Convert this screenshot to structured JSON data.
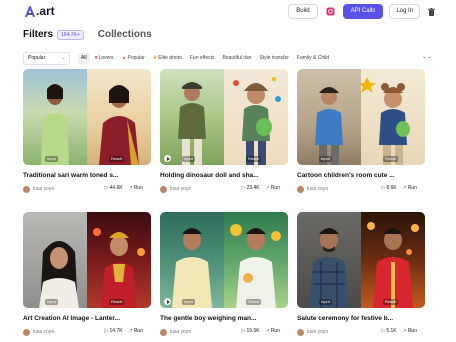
{
  "header": {
    "logo_text": ".art",
    "build_label": "Build",
    "api_label": "API Calls",
    "login_label": "Log In"
  },
  "colors": {
    "accent": "#5a52e8",
    "text": "#111111"
  },
  "titles": {
    "filters": "Filters",
    "count_badge": "154.7K+",
    "collections": "Collections"
  },
  "filters": {
    "sort_value": "Popular",
    "chips": [
      {
        "label": "All",
        "icon": ""
      },
      {
        "label": "Lovers",
        "icon": "heart-icon"
      },
      {
        "label": "Popular",
        "icon": "fire-icon"
      },
      {
        "label": "Elite photo",
        "icon": "crown-icon"
      },
      {
        "label": "Fun effects",
        "icon": ""
      },
      {
        "label": "Beautiful tian",
        "icon": ""
      },
      {
        "label": "Style transfer",
        "icon": ""
      },
      {
        "label": "Family & Child",
        "icon": ""
      }
    ]
  },
  "cards": [
    {
      "title": "Traditional sari warm toned s...",
      "author": "lusa yoyo",
      "views": "44.6K",
      "runs": "Run",
      "input_tag": "Input",
      "result_tag": "Result"
    },
    {
      "title": "Holding dinosaur doll and sha...",
      "author": "lusa yoyo",
      "views": "23.4K",
      "runs": "Run",
      "input_tag": "Input",
      "result_tag": "Result"
    },
    {
      "title": "Cartoon children's room cute ...",
      "author": "lusa yoyo",
      "views": "8.6K",
      "runs": "Run",
      "input_tag": "Input",
      "result_tag": "Result"
    },
    {
      "title": "Art Creation AI Image - Lanter...",
      "author": "lusa yoyo",
      "views": "14.7K",
      "runs": "Run",
      "input_tag": "Input",
      "result_tag": "Result"
    },
    {
      "title": "The gentle boy weighing man...",
      "author": "lusa yoyo",
      "views": "19.5K",
      "runs": "Run",
      "input_tag": "Input",
      "result_tag": "Result"
    },
    {
      "title": "Salute ceremony for festive b...",
      "author": "lusa yoyo",
      "views": "5.1K",
      "runs": "Run",
      "input_tag": "Input",
      "result_tag": "Result"
    }
  ]
}
